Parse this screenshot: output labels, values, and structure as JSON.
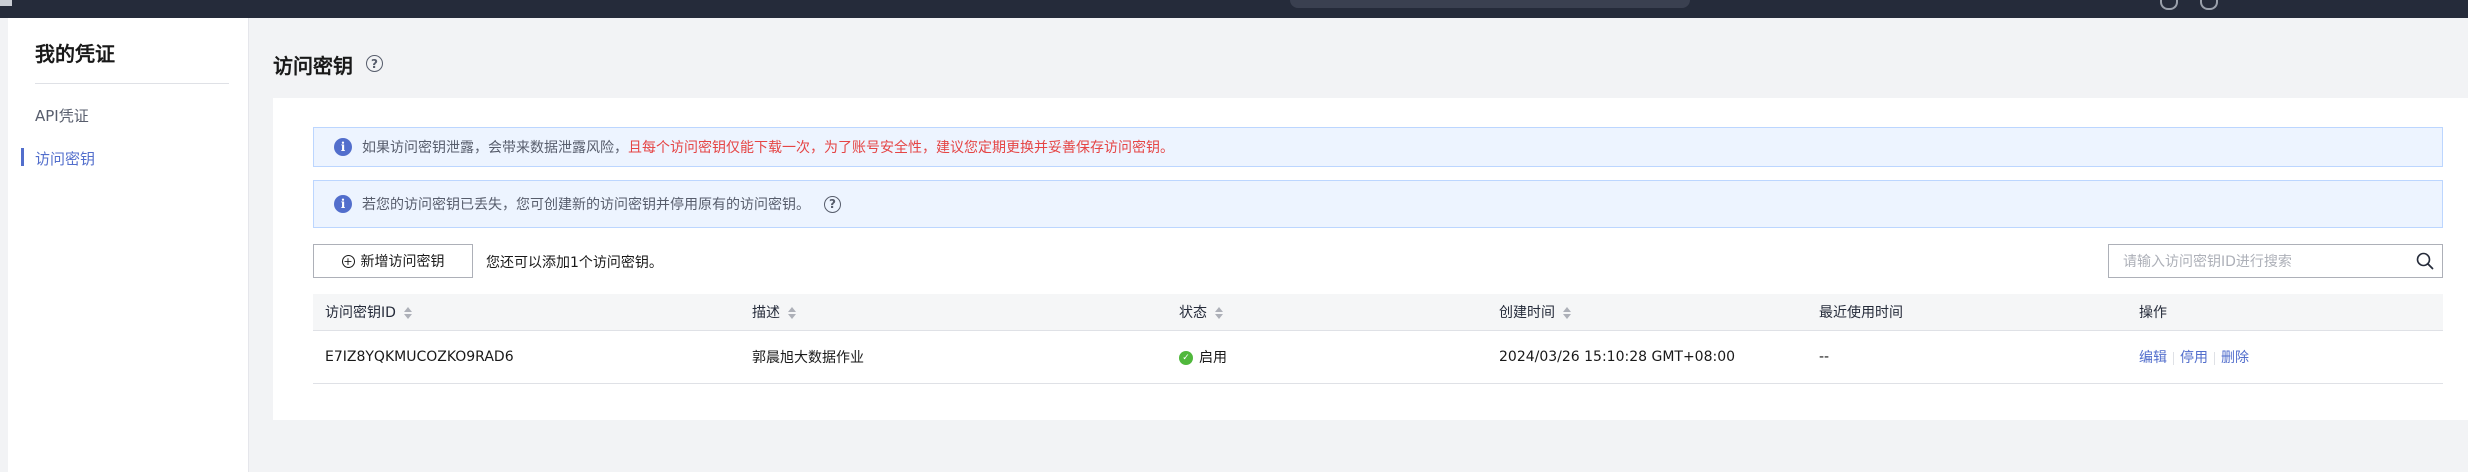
{
  "sidebar": {
    "title": "我的凭证",
    "items": [
      {
        "label": "API凭证",
        "active": false
      },
      {
        "label": "访问密钥",
        "active": true
      }
    ]
  },
  "page": {
    "title": "访问密钥"
  },
  "notices": [
    {
      "normal_text": "如果访问密钥泄露，会带来数据泄露风险，",
      "warn_text": "且每个访问密钥仅能下载一次，为了账号安全性，建议您定期更换并妥善保存访问密钥。"
    },
    {
      "normal_text": "若您的访问密钥已丢失，您可创建新的访问密钥并停用原有的访问密钥。",
      "warn_text": ""
    }
  ],
  "toolbar": {
    "add_button_label": "新增访问密钥",
    "quota_text": "您还可以添加1个访问密钥。",
    "search_placeholder": "请输入访问密钥ID进行搜索"
  },
  "table": {
    "columns": [
      "访问密钥ID",
      "描述",
      "状态",
      "创建时间",
      "最近使用时间",
      "操作"
    ],
    "rows": [
      {
        "id": "E7IZ8YQKMUCOZKO9RAD6",
        "description": "郭晨旭大数据作业",
        "status": "启用",
        "created": "2024/03/26 15:10:28 GMT+08:00",
        "last_used": "--",
        "actions": [
          "编辑",
          "停用",
          "删除"
        ]
      }
    ]
  },
  "colors": {
    "accent": "#526ecc",
    "warning": "#e54545",
    "success": "#50b83c",
    "notice_bg": "#edf4ff"
  },
  "icons": [
    "info-icon",
    "help-icon",
    "plus-circle-icon",
    "search-icon",
    "sort-icon",
    "check-circle-icon"
  ]
}
